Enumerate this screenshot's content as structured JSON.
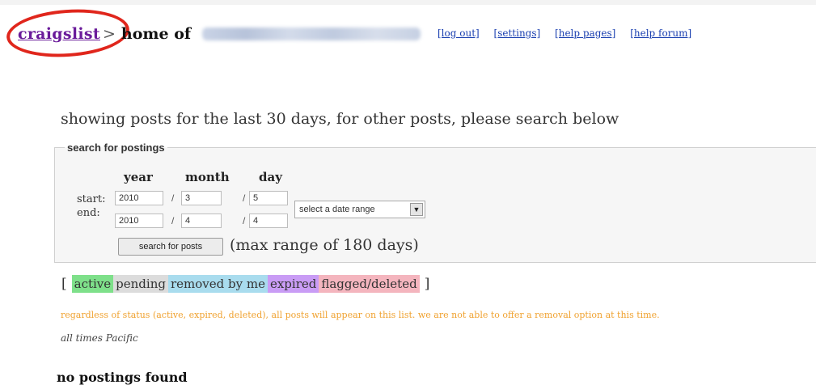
{
  "header": {
    "brand": "craigslist",
    "separator": ">",
    "home_of": "home of",
    "links": [
      "[log out]",
      "[settings]",
      "[help pages]",
      "[help forum]"
    ]
  },
  "showing_text": "showing posts for the last 30 days, for other posts, please search below",
  "search": {
    "legend": "search for postings",
    "columns": [
      "year",
      "month",
      "day"
    ],
    "start_label": "start:",
    "end_label": "end:",
    "start": {
      "year": "2010",
      "month": "3",
      "day": "5"
    },
    "end": {
      "year": "2010",
      "month": "4",
      "day": "4"
    },
    "slash": "/",
    "date_range_select": "select a date range",
    "button_label": "search for posts",
    "max_range": "(max range of 180 days)"
  },
  "status_legend": {
    "open": "[",
    "close": "]",
    "items": [
      "active",
      "pending",
      "removed by me",
      "expired",
      "flagged/deleted"
    ]
  },
  "notice": "regardless of status (active, expired, deleted), all posts will appear on this list. we are not able to offer a removal option at this time.",
  "timezone": "all times Pacific",
  "empty_message": "no postings found",
  "colors": {
    "brand": "#6a1b9a",
    "link": "#1a3fb0",
    "highlight_circle": "#e0261c",
    "active": "#7ee08a",
    "pending": "#dcdcdc",
    "removed": "#a9dcee",
    "expired": "#c99cf5",
    "flagged": "#f4b5be",
    "notice": "#f0a230"
  }
}
